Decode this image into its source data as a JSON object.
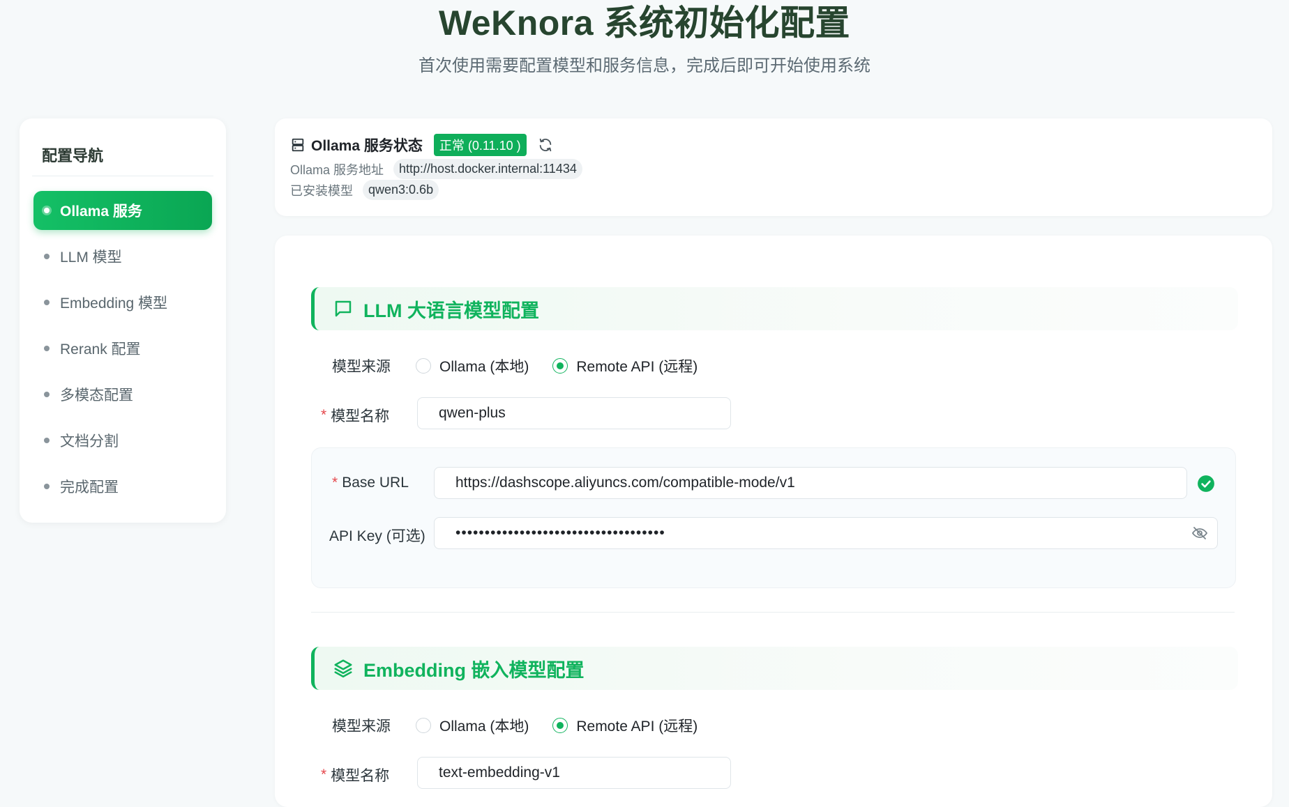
{
  "page": {
    "title": "WeKnora 系统初始化配置",
    "subtitle": "首次使用需要配置模型和服务信息，完成后即可开始使用系统"
  },
  "sidebar": {
    "title": "配置导航",
    "items": [
      {
        "label": "Ollama 服务",
        "active": true
      },
      {
        "label": "LLM 模型",
        "active": false
      },
      {
        "label": "Embedding 模型",
        "active": false
      },
      {
        "label": "Rerank 配置",
        "active": false
      },
      {
        "label": "多模态配置",
        "active": false
      },
      {
        "label": "文档分割",
        "active": false
      },
      {
        "label": "完成配置",
        "active": false
      }
    ]
  },
  "ollama_status": {
    "title": "Ollama 服务状态",
    "badge": "正常 (0.11.10 )",
    "address_label": "Ollama 服务地址",
    "address_value": "http://host.docker.internal:11434",
    "models_label": "已安装模型",
    "models_value": "qwen3:0.6b"
  },
  "llm": {
    "section_title": "LLM 大语言模型配置",
    "source_label": "模型来源",
    "source_options": [
      "Ollama (本地)",
      "Remote API (远程)"
    ],
    "source_selected": "Remote API (远程)",
    "model_name_label": "模型名称",
    "model_name_value": "qwen-plus",
    "base_url_label": "Base URL",
    "base_url_value": "https://dashscope.aliyuncs.com/compatible-mode/v1",
    "api_key_label": "API Key (可选)",
    "api_key_value": "••••••••••••••••••••••••••••••••••••"
  },
  "embedding": {
    "section_title": "Embedding 嵌入模型配置",
    "source_label": "模型来源",
    "source_options": [
      "Ollama (本地)",
      "Remote API (远程)"
    ],
    "source_selected": "Remote API (远程)",
    "model_name_label": "模型名称",
    "model_name_value": "text-embedding-v1"
  },
  "colors": {
    "accent": "#10b35d",
    "title": "#27452f",
    "background": "#f6f9fa"
  },
  "icons": {
    "status": "server-icon",
    "refresh": "refresh-icon",
    "llm": "message-square-icon",
    "embedding": "layers-icon",
    "url_ok": "check-circle-icon",
    "api_key": "eye-off-icon"
  }
}
